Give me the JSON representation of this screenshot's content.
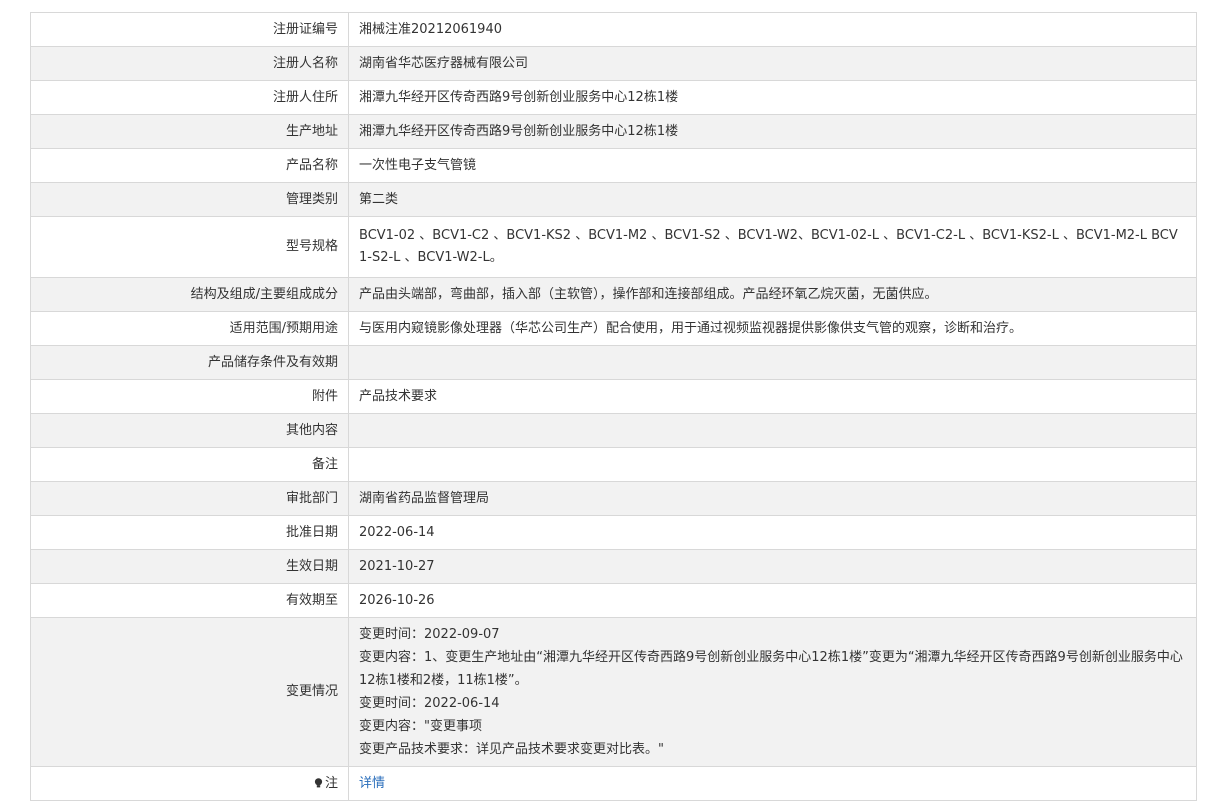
{
  "rows": [
    {
      "label": "注册证编号",
      "value": "湘械注准20212061940"
    },
    {
      "label": "注册人名称",
      "value": "湖南省华芯医疗器械有限公司"
    },
    {
      "label": "注册人住所",
      "value": "湘潭九华经开区传奇西路9号创新创业服务中心12栋1楼"
    },
    {
      "label": "生产地址",
      "value": "湘潭九华经开区传奇西路9号创新创业服务中心12栋1楼"
    },
    {
      "label": "产品名称",
      "value": "一次性电子支气管镜"
    },
    {
      "label": "管理类别",
      "value": "第二类"
    },
    {
      "label": "型号规格",
      "value": "BCV1-02 、BCV1-C2 、BCV1-KS2 、BCV1-M2 、BCV1-S2 、BCV1-W2、BCV1-02-L 、BCV1-C2-L 、BCV1-KS2-L 、BCV1-M2-L BCV1-S2-L 、BCV1-W2-L。"
    },
    {
      "label": "结构及组成/主要组成成分",
      "value": "产品由头端部，弯曲部，插入部（主软管），操作部和连接部组成。产品经环氧乙烷灭菌，无菌供应。"
    },
    {
      "label": "适用范围/预期用途",
      "value": "与医用内窥镜影像处理器（华芯公司生产）配合使用，用于通过视频监视器提供影像供支气管的观察，诊断和治疗。"
    },
    {
      "label": "产品储存条件及有效期",
      "value": ""
    },
    {
      "label": "附件",
      "value": "产品技术要求"
    },
    {
      "label": "其他内容",
      "value": ""
    },
    {
      "label": "备注",
      "value": ""
    },
    {
      "label": "审批部门",
      "value": "湖南省药品监督管理局"
    },
    {
      "label": "批准日期",
      "value": "2022-06-14"
    },
    {
      "label": "生效日期",
      "value": "2021-10-27"
    },
    {
      "label": "有效期至",
      "value": "2026-10-26"
    }
  ],
  "changes": {
    "label": "变更情况",
    "lines": [
      "变更时间：2022-09-07",
      "变更内容：1、变更生产地址由“湘潭九华经开区传奇西路9号创新创业服务中心12栋1楼”变更为“湘潭九华经开区传奇西路9号创新创业服务中心12栋1楼和2楼，11栋1楼”。",
      "变更时间：2022-06-14",
      "变更内容：\"变更事项",
      "变更产品技术要求：详见产品技术要求变更对比表。\""
    ]
  },
  "note": {
    "label": "注",
    "icon": "bulb-icon",
    "link_text": "详情",
    "link_color": "#2a6ebb"
  }
}
